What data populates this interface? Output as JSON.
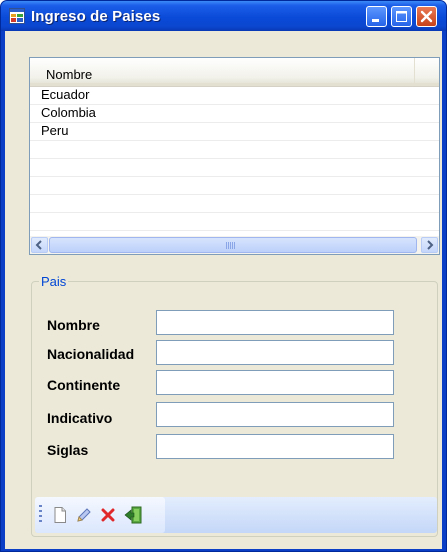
{
  "window": {
    "title": "Ingreso de Paises"
  },
  "list": {
    "column_header": "Nombre",
    "rows": [
      "Ecuador",
      "Colombia",
      "Peru"
    ]
  },
  "group": {
    "legend": "Pais",
    "fields": {
      "nombre": {
        "label": "Nombre",
        "value": ""
      },
      "nacionalidad": {
        "label": "Nacionalidad",
        "value": ""
      },
      "continente": {
        "label": "Continente",
        "value": ""
      },
      "indicativo": {
        "label": "Indicativo",
        "value": ""
      },
      "siglas": {
        "label": "Siglas",
        "value": ""
      }
    }
  },
  "toolbar": {
    "buttons": [
      "new-document-icon",
      "edit-pencil-icon",
      "delete-x-icon",
      "exit-door-icon"
    ]
  },
  "colors": {
    "title_bar": "#0a4ad8",
    "group_legend": "#0046d5",
    "client_bg": "#ece9d8"
  }
}
